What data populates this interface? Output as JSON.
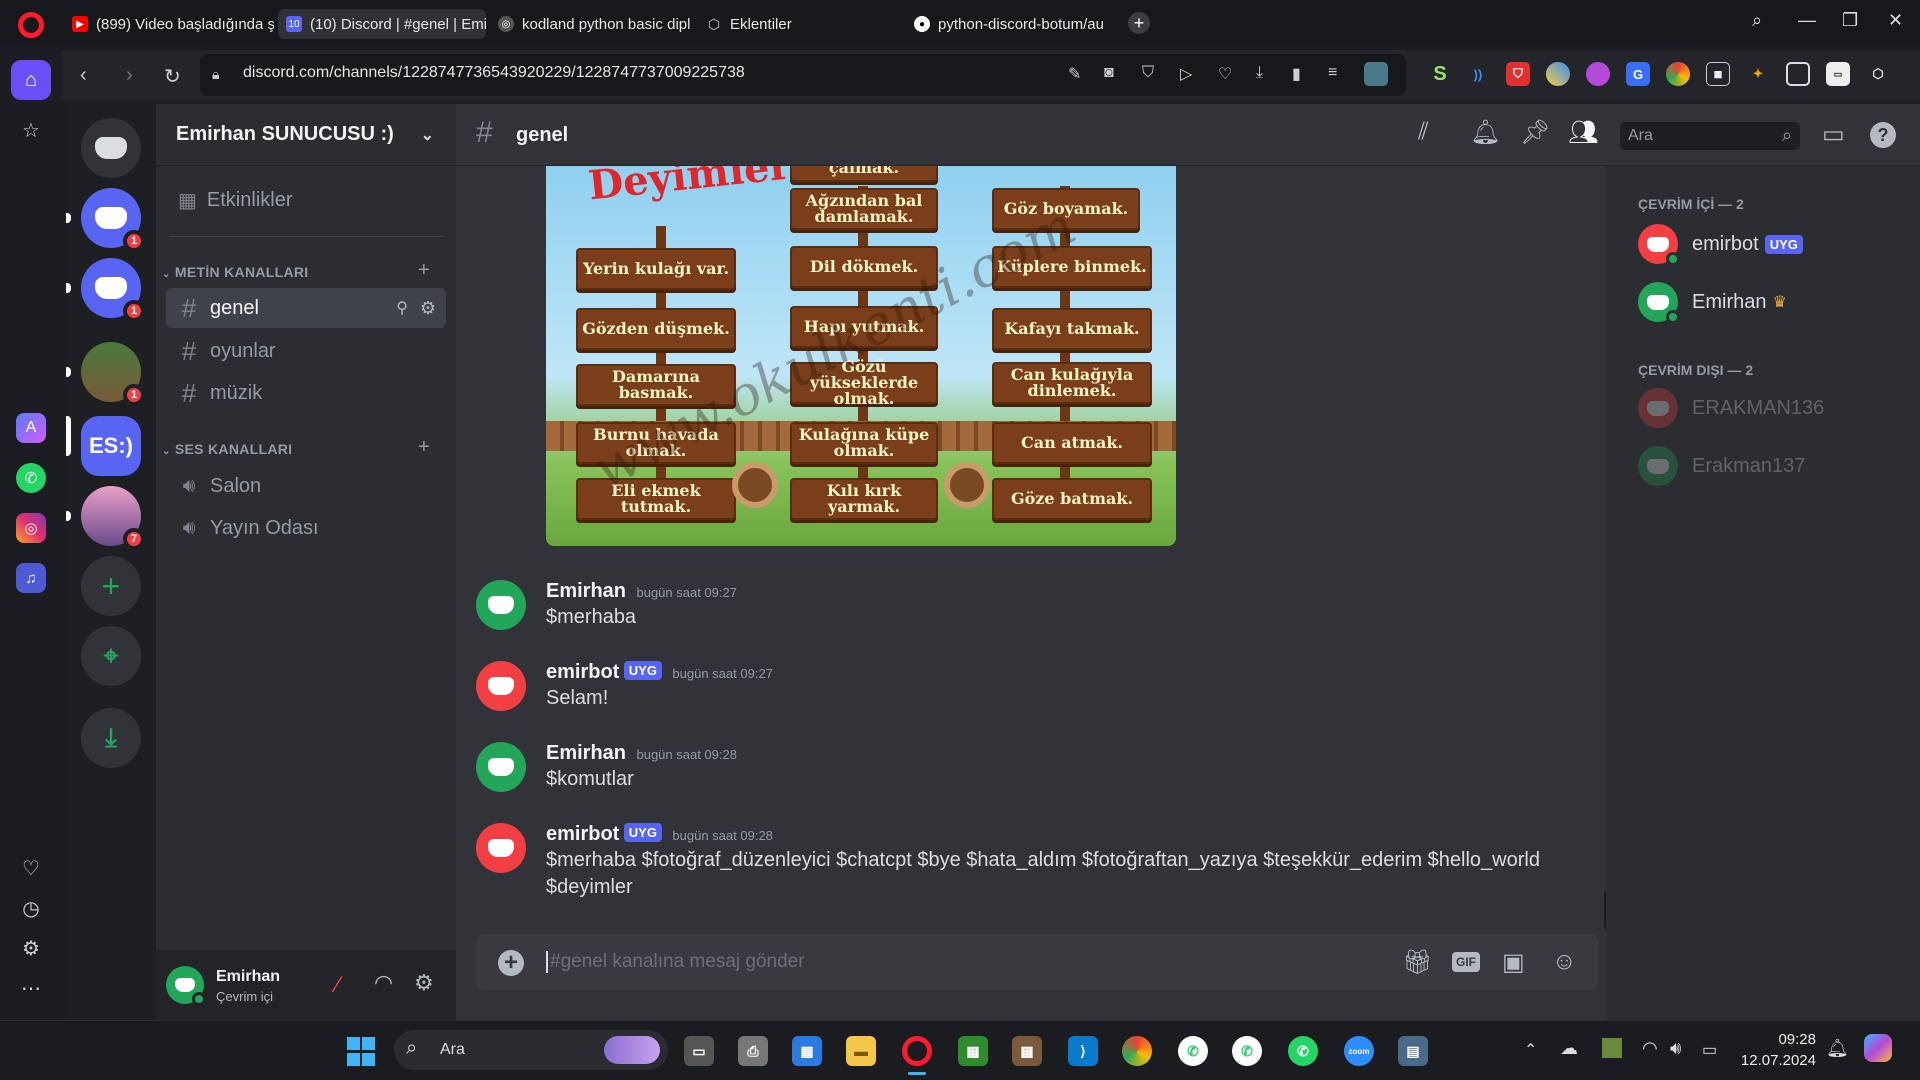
{
  "browser": {
    "tabs": [
      {
        "label": "(899) Video başladığında ş",
        "icon": "youtube-icon",
        "color": "#ff0000"
      },
      {
        "label": "(10) Discord | #genel | Emi",
        "icon": "discord-icon",
        "color": "#5865f2",
        "active": true
      },
      {
        "label": "kodland python basic dipl",
        "icon": "globe-icon",
        "color": "#cccccc"
      },
      {
        "label": "Eklentiler",
        "icon": "cube-icon",
        "color": "#cccccc"
      },
      {
        "label": "python-discord-botum/au",
        "icon": "github-icon",
        "color": "#ffffff"
      }
    ],
    "new_tab": "+",
    "url": "discord.com/channels/1228747736543920229/1228747737009225738"
  },
  "discord": {
    "server_name": "Emirhan SUNUCUSU :)",
    "events_label": "Etkinlikler",
    "text_category": "METİN KANALLARI",
    "text_channels": [
      "genel",
      "oyunlar",
      "müzik"
    ],
    "voice_category": "SES KANALLARI",
    "voice_channels": [
      "Salon",
      "Yayın Odası"
    ],
    "guild_badges": [
      "1",
      "1",
      "1",
      "7"
    ],
    "guild_es_label": "ES:)",
    "channel_title": "genel",
    "search_placeholder": "Ara",
    "user": {
      "name": "Emirhan",
      "status": "Çevrim içi"
    },
    "composer_placeholder": "#genel kanalına mesaj gönder",
    "gif_label": "GIF",
    "messages": [
      {
        "author": "Emirhan",
        "time": "bugün saat 09:27",
        "text": "$merhaba",
        "bot": false,
        "color": "#23a55a"
      },
      {
        "author": "emirbot",
        "time": "bugün saat 09:27",
        "text": "Selam!",
        "bot": true,
        "color": "#f23f43"
      },
      {
        "author": "Emirhan",
        "time": "bugün saat 09:28",
        "text": "$komutlar",
        "bot": false,
        "color": "#23a55a"
      },
      {
        "author": "emirbot",
        "time": "bugün saat 09:28",
        "text": "$merhaba $fotoğraf_düzenleyici $chatcpt $bye $hata_aldım $fotoğraftan_yazıya $teşekkür_ederim $hello_world $deyimler",
        "bot": true,
        "color": "#f23f43"
      }
    ],
    "bot_tag": "UYG",
    "members": {
      "online_header": "ÇEVRİM İÇİ — 2",
      "online": [
        {
          "name": "emirbot",
          "color": "#f23f43"
        },
        {
          "name": "Emirhan",
          "color": "#23a55a"
        }
      ],
      "offline_header": "ÇEVRİM DIŞI — 2",
      "offline": [
        {
          "name": "ERAKMAN136",
          "color": "#f23f43"
        },
        {
          "name": "Erakman137",
          "color": "#23a55a"
        }
      ]
    },
    "idiom_image": {
      "title": "Deyimler",
      "signs": [
        "çalmak.",
        "Ağzından bal damlamak.",
        "Göz boyamak.",
        "Yerin kulağı var.",
        "Dil dökmek.",
        "Küplere binmek.",
        "Gözden düşmek.",
        "Hapı yutmak.",
        "Kafayı takmak.",
        "Damarına basmak.",
        "Gözü yükseklerde olmak.",
        "Can kulağıyla dinlemek.",
        "Burnu havada olmak.",
        "Kulağına küpe olmak.",
        "Can atmak.",
        "Eli ekmek tutmak.",
        "Kılı kırk yarmak.",
        "Göze batmak."
      ],
      "watermark": "www.okulkenti.com"
    }
  },
  "taskbar": {
    "search_label": "Ara",
    "time": "09:28",
    "date": "12.07.2024"
  }
}
